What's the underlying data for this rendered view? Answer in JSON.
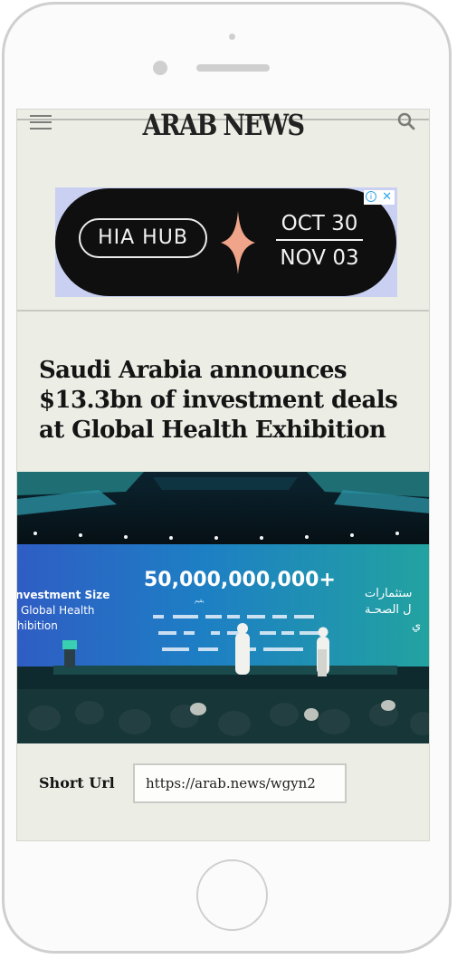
{
  "site": {
    "logo": "ARAB NEWS"
  },
  "icons": {
    "menu": "hamburger-menu-icon",
    "search": "search-icon",
    "ad_info": "info-icon",
    "ad_close": "close-icon"
  },
  "ad": {
    "brand": "HIA HUB",
    "date_start": "OCT 30",
    "date_end": "NOV 03",
    "info_glyph": "i",
    "close_glyph": "✕"
  },
  "article": {
    "headline": "Saudi Arabia announces $13.3bn of investment deals at Global Health Exhibition",
    "image": {
      "screen_number": "50,000,000,000+",
      "screen_left_text": [
        "nvestment Size",
        "Global Health",
        "hibition"
      ],
      "screen_right_text": [
        "ستثمارات",
        "ل الصحـة",
        "ي"
      ]
    }
  },
  "short_url": {
    "label": "Short Url",
    "value": "https://arab.news/wgyn2"
  },
  "colors": {
    "ad_bg": "#c9d0f2",
    "ad_accent": "#f0a58a",
    "screen_bg": "#eceee6"
  }
}
